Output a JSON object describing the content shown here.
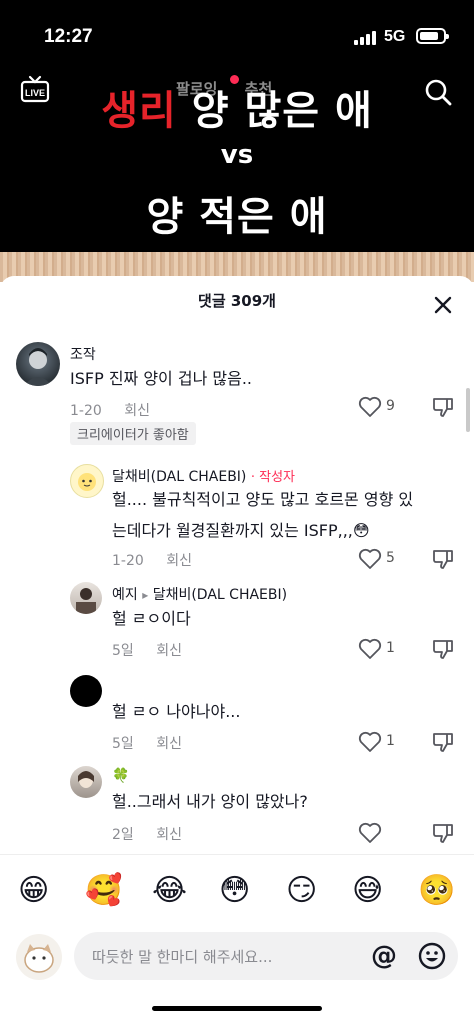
{
  "status": {
    "time": "12:27",
    "network": "5G"
  },
  "nav": {
    "tabs": [
      "팔로잉",
      "추천"
    ]
  },
  "video": {
    "line1_red": "생리",
    "line1_white": "양 많은 애",
    "vs": "vs",
    "line3": "양 적은 애"
  },
  "sheet": {
    "title": "댓글 309개"
  },
  "comments": [
    {
      "user": "조작",
      "text": "ISFP 진짜 양이 겁나 많음..",
      "date": "1-20",
      "reply": "회신",
      "likes": "9",
      "badge": "크리에이터가 좋아함"
    },
    {
      "user": "달채비(DAL CHAEBI)",
      "author_tag": "· 작성자",
      "text_line1": "헐.... 불규칙적이고 양도 많고 호르몬 영향 있",
      "text_line2": "는데다가 월경질환까지 있는 ISFP,,,😳",
      "date": "1-20",
      "reply": "회신",
      "likes": "5"
    },
    {
      "user": "예지",
      "arrow": "▸",
      "reply_to": "달채비(DAL CHAEBI)",
      "text": "헐 ㄹㅇ이다",
      "date": "5일",
      "reply": "회신",
      "likes": "1"
    },
    {
      "user": "",
      "text": "헐 ㄹㅇ 나야나야...",
      "date": "5일",
      "reply": "회신",
      "likes": "1"
    },
    {
      "user": "🍀",
      "text": "헐..그래서 내가 양이 많았나?",
      "date": "2일",
      "reply": "회신",
      "likes": ""
    }
  ],
  "emojis": [
    "😁",
    "🥰",
    "😂",
    "😳",
    "😏",
    "😅",
    "🥺"
  ],
  "input": {
    "placeholder": "따듯한 말 한마디 해주세요...",
    "at": "@"
  }
}
